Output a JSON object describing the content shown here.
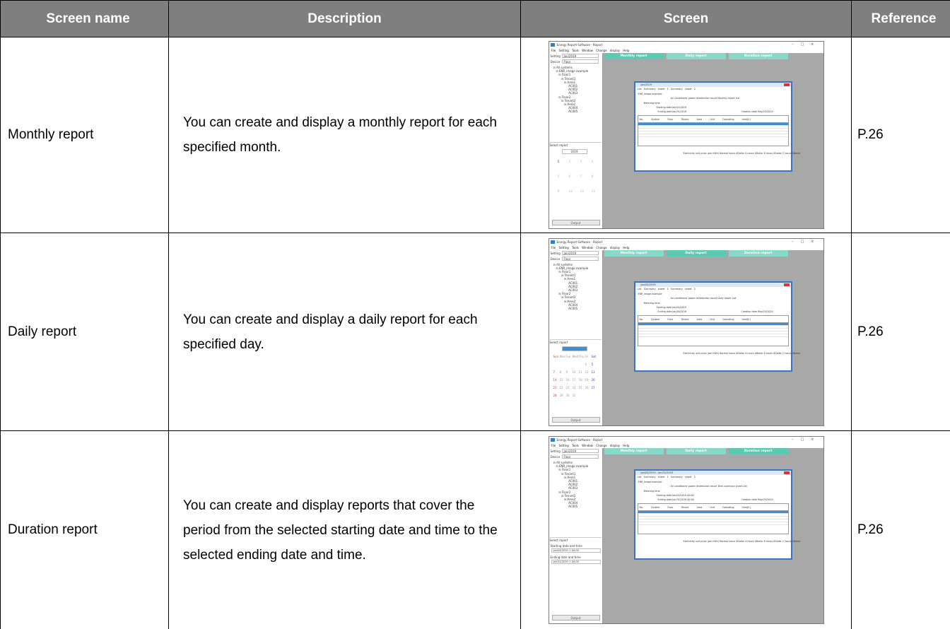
{
  "headers": {
    "name": "Screen name",
    "description": "Description",
    "screen": "Screen",
    "reference": "Reference"
  },
  "rows": [
    {
      "name": "Monthly report",
      "description": "You can create and display a monthly report for each specified month.",
      "reference": "P.26"
    },
    {
      "name": "Daily report",
      "description": "You can create and display a daily report for each specified day.",
      "reference": "P.26"
    },
    {
      "name": "Duration report",
      "description": "You can create and display reports that cover the period from the selected starting date and time to the selected ending date and time.",
      "reference": "P.26"
    }
  ],
  "screenshot": {
    "window_title": "Energy Report Software - Report",
    "menu": "File  Setting  Tools  Window  Change display  Help",
    "setting_label": "Setting",
    "setting_value": "Jan/2019",
    "device_label": "Device",
    "device_value": "Floor",
    "tabs": [
      "Monthly report",
      "Daily report",
      "Duration report"
    ],
    "tree": "⊟ All systems\n   ⊟ ENR_image example\n      ⊟ Floor1\n         ⊟ Tenant1\n            ⊟ Area1\n                 AC001\n                 AC002\n                 AC003\n      ⊟ Floor2\n         ⊟ Tenant2\n            ⊟ Area2\n                 AC004\n                 AC005",
    "select_report": "Select report",
    "output": "Output",
    "year": "2019",
    "months": [
      "1",
      "2",
      "3",
      "4",
      "5",
      "6",
      "7",
      "8",
      "9",
      "10",
      "11",
      "12"
    ],
    "calendar": [
      "Sun",
      "Mon",
      "Tue",
      "Wed",
      "Thu",
      "Fri",
      "Sat",
      "",
      "",
      "",
      "",
      "",
      "4",
      "5",
      "7",
      "8",
      "9",
      "10",
      "11",
      "12",
      "13",
      "14",
      "15",
      "16",
      "17",
      "18",
      "19",
      "20",
      "21",
      "22",
      "23",
      "24",
      "25",
      "26",
      "27",
      "28",
      "29",
      "30",
      "31",
      "",
      ""
    ],
    "starting_label": "Starting date and time",
    "starting_value": "Jan/04/2019    ↗  00:00",
    "ending_label": "Ending date and time",
    "ending_value": "Jan/31/2019    ↗  00:00",
    "report_titles": [
      "Jan/2019",
      "Jan/04/2019",
      "Jan/04/2019 - Jan/31/2019"
    ],
    "sheets": "List    Summary sheet 1    Summary sheet 2",
    "site": "ENR_image example",
    "result_titles": [
      "Air conditioner power distribution result  Monthly report List",
      "Air conditioner power distribution result  Daily report List",
      "Air conditioner power distribution result  Term summary sheet List"
    ],
    "metering_time": "Metering time",
    "starting_dates": [
      "Starting date   Jan/01/2019",
      "Starting date   Jan/04/2019",
      "Starting date   Jan/04/2019 00:00"
    ],
    "ending_dates": [
      "Ending date   Jan/31/2019",
      "Ending date   Jan/04/2019",
      "Ending date   Jan/31/2019 00:00"
    ],
    "creation_date": "Creation date   May/25/2020",
    "columns": "No.  System  Floor  Tenant  Area  Unit  Operating time[h]",
    "footer": "Electricity unit price (per kWh)   Normal hours 0Dollar   4 hours 0Dollar   8 hours 0Dollar   C hours 0Dollar"
  }
}
